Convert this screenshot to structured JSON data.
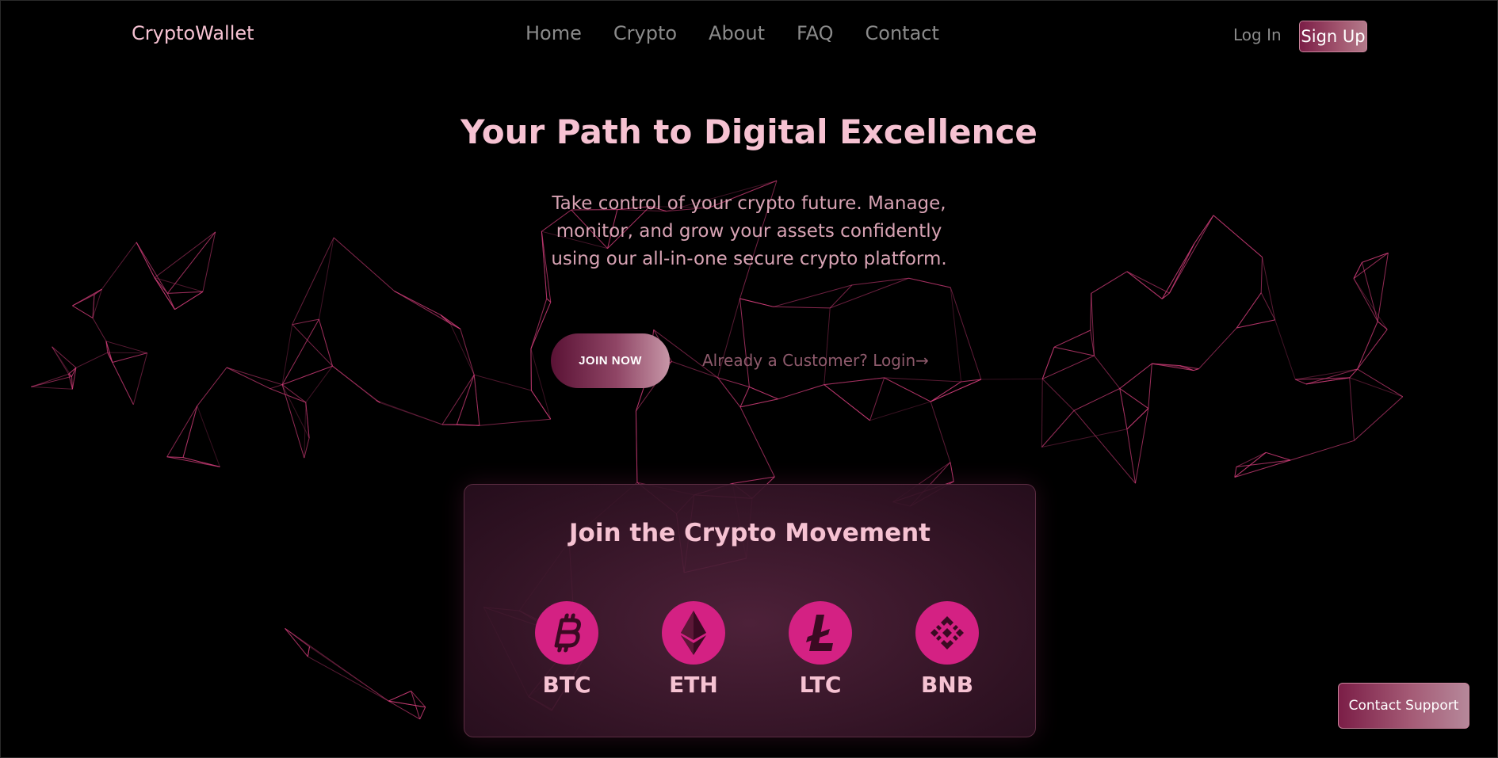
{
  "nav": {
    "logo": "CryptoWallet",
    "links": [
      {
        "label": "Home"
      },
      {
        "label": "Crypto"
      },
      {
        "label": "About"
      },
      {
        "label": "FAQ"
      },
      {
        "label": "Contact"
      }
    ],
    "login_label": "Log In",
    "signup_label": "Sign Up"
  },
  "hero": {
    "title": "Your Path to Digital Excellence",
    "description": "Take control of your crypto future. Manage, monitor, and grow your assets confidently using our all-in-one secure crypto platform.",
    "join_label": "JOIN NOW",
    "customer_link": "Already a Customer? Login→"
  },
  "card": {
    "title": "Join the Crypto Movement",
    "coins": [
      {
        "symbol": "BTC",
        "icon": "bitcoin-icon"
      },
      {
        "symbol": "ETH",
        "icon": "ethereum-icon"
      },
      {
        "symbol": "LTC",
        "icon": "litecoin-icon"
      },
      {
        "symbol": "BNB",
        "icon": "binance-icon"
      }
    ]
  },
  "support": {
    "label": "Contact Support"
  },
  "colors": {
    "background": "#000000",
    "accent_pink": "#f6c2d2",
    "coin_magenta": "#d42183",
    "network_line": "#d8407e"
  }
}
